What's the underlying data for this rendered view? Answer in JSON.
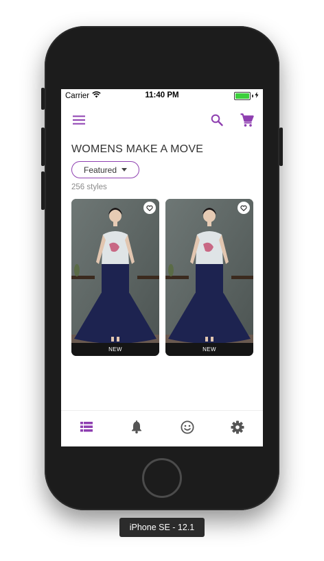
{
  "status_bar": {
    "carrier": "Carrier",
    "time": "11:40 PM",
    "wifi_icon": "wifi-icon",
    "battery_icon": "battery-icon",
    "charging_icon": "bolt-icon",
    "battery_color": "#3ccf3c"
  },
  "app_bar": {
    "menu_icon": "menu-icon",
    "search_icon": "search-icon",
    "cart_icon": "cart-icon"
  },
  "page": {
    "title": "WOMENS MAKE A MOVE",
    "sort_label": "Featured",
    "count_label": "256 styles"
  },
  "products": [
    {
      "badge": "NEW",
      "favorite_icon": "heart-outline-icon"
    },
    {
      "badge": "NEW",
      "favorite_icon": "heart-outline-icon"
    }
  ],
  "bottom_nav": [
    {
      "icon": "list-icon",
      "active": true
    },
    {
      "icon": "bell-icon",
      "active": false
    },
    {
      "icon": "smiley-icon",
      "active": false
    },
    {
      "icon": "gear-icon",
      "active": false
    }
  ],
  "device_label": "iPhone SE - 12.1",
  "colors": {
    "accent": "#8e3fb0",
    "nav_inactive": "#555555",
    "device_body": "#1c1c1c"
  }
}
